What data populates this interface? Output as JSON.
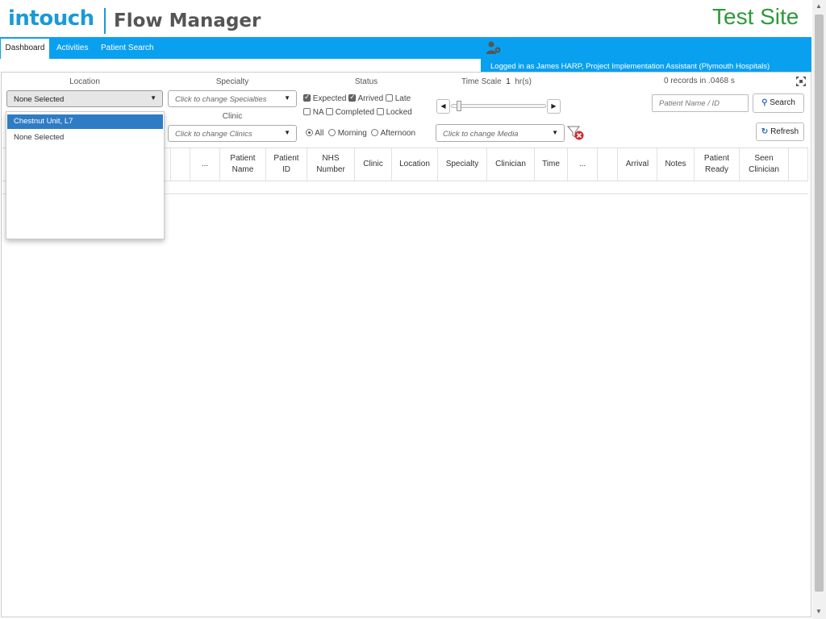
{
  "header": {
    "logo_in": "intouch",
    "logo_product": "Flow Manager",
    "site_label": "Test Site"
  },
  "nav": {
    "tabs": [
      {
        "label": "Dashboard",
        "active": true
      },
      {
        "label": "Activities",
        "active": false
      },
      {
        "label": "Patient Search",
        "active": false
      }
    ],
    "user_icon": "user-settings-icon",
    "logged_in_text": "Logged in as James HARP, Project Implementation Assistant (Plymouth Hospitals)"
  },
  "filters": {
    "location": {
      "label": "Location",
      "value": "None Selected"
    },
    "specialty": {
      "label": "Specialty",
      "placeholder": "Click to change Specialties"
    },
    "clinic": {
      "label": "Clinic",
      "placeholder": "Click to change Clinics"
    },
    "status": {
      "label": "Status",
      "options": [
        {
          "label": "Expected",
          "checked": true
        },
        {
          "label": "Arrived",
          "checked": true
        },
        {
          "label": "Late",
          "checked": false
        },
        {
          "label": "NA",
          "checked": false
        },
        {
          "label": "Completed",
          "checked": false
        },
        {
          "label": "Locked",
          "checked": false
        }
      ]
    },
    "timescale": {
      "label": "Time Scale",
      "value": "1",
      "unit": "hr(s)"
    },
    "session": {
      "options": [
        {
          "label": "All",
          "selected": true
        },
        {
          "label": "Morning",
          "selected": false
        },
        {
          "label": "Afternoon",
          "selected": false
        }
      ]
    },
    "media": {
      "placeholder": "Click to change Media"
    },
    "clear_filter_icon": "filter-clear-icon"
  },
  "records": {
    "count_text": "0 records in .0468 s"
  },
  "search": {
    "placeholder": "Patient Name / ID",
    "button_label": "Search",
    "icon": "search-icon"
  },
  "refresh": {
    "button_label": "Refresh",
    "icon": "refresh-icon"
  },
  "expand_icon": "expand-icon",
  "location_dropdown": {
    "items": [
      {
        "label": "Chestnut Unit, L7",
        "highlighted": true
      },
      {
        "label": "None Selected",
        "highlighted": false
      }
    ]
  },
  "grid": {
    "columns": [
      "",
      "",
      "...",
      "Patient\nName",
      "Patient\nID",
      "NHS\nNumber",
      "Clinic",
      "Location",
      "Specialty",
      "Clinician",
      "Time",
      "...",
      "",
      "Arrival",
      "Notes",
      "Patient\nReady",
      "Seen\nClinician",
      ""
    ]
  },
  "colors": {
    "accent": "#0aa0f0",
    "brand": "#1a9ad6",
    "site": "#2b9a3a",
    "selection": "#2e7cc4"
  }
}
